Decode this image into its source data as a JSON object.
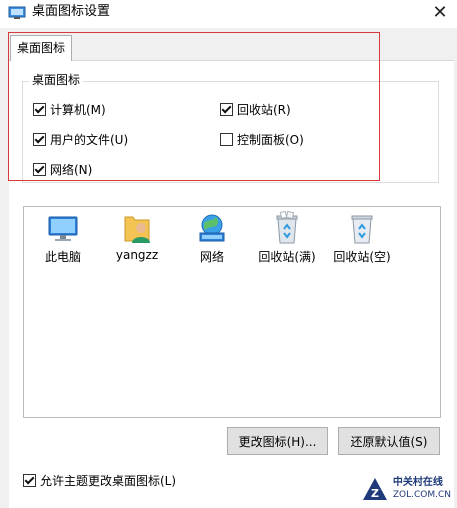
{
  "window": {
    "title": "桌面图标设置",
    "close_glyph": "✕"
  },
  "tabs": [
    {
      "label": "桌面图标"
    }
  ],
  "group": {
    "legend": "桌面图标",
    "checkboxes": [
      {
        "label": "计算机(M)",
        "checked": true
      },
      {
        "label": "回收站(R)",
        "checked": true
      },
      {
        "label": "用户的文件(U)",
        "checked": true
      },
      {
        "label": "控制面板(O)",
        "checked": false
      },
      {
        "label": "网络(N)",
        "checked": true
      }
    ]
  },
  "icons": [
    {
      "label": "此电脑",
      "icon": "computer-icon"
    },
    {
      "label": "yangzz",
      "icon": "user-folder-icon"
    },
    {
      "label": "网络",
      "icon": "network-icon"
    },
    {
      "label": "回收站(满)",
      "icon": "recycle-bin-full-icon"
    },
    {
      "label": "回收站(空)",
      "icon": "recycle-bin-empty-icon"
    }
  ],
  "buttons": {
    "change_icon": "更改图标(H)...",
    "restore_default": "还原默认值(S)"
  },
  "allow_themes": {
    "label": "允许主题更改桌面图标(L)",
    "checked": true
  },
  "watermark": {
    "cn": "中关村在线",
    "en": "ZOL.COM.CN",
    "logo_letter": "Z"
  },
  "colors": {
    "highlight_frame": "#d63a3a",
    "button_bg": "#e1e1e1"
  }
}
